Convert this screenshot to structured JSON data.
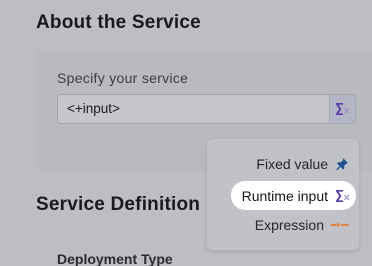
{
  "about_section": {
    "title": "About the Service",
    "field_label": "Specify your service",
    "input_value": "<+input>"
  },
  "service_definition": {
    "title": "Service Definition",
    "deployment_type_label": "Deployment Type"
  },
  "input_type_menu": {
    "items": [
      {
        "label": "Fixed value",
        "icon": "pin-icon",
        "selected": false
      },
      {
        "label": "Runtime input",
        "icon": "runtime-input-icon",
        "selected": true
      },
      {
        "label": "Expression",
        "icon": "expression-icon",
        "selected": false
      }
    ]
  },
  "colors": {
    "runtime_accent": "#5a3fa8",
    "pin_blue": "#1d4f91",
    "expression_orange": "#e0823a"
  }
}
